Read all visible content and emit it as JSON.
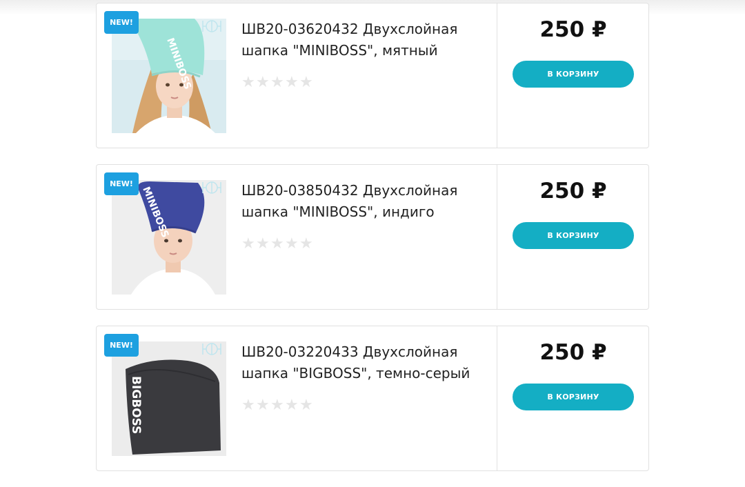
{
  "products": [
    {
      "badge": "NEW!",
      "title": "ШВ20-03620432 Двухслойная шапка \"MINIBOSS\", мятный",
      "price": "250 ₽",
      "rating_stars": 5,
      "rating_value": 0,
      "cart_label": "В КОРЗИНУ",
      "hat_print": "MINIBOSS",
      "hat_color": "#9ee3d8",
      "bg_color": "#d9ebf0"
    },
    {
      "badge": "NEW!",
      "title": "ШВ20-03850432 Двухслойная шапка \"MINIBOSS\", индиго",
      "price": "250 ₽",
      "rating_stars": 5,
      "rating_value": 0,
      "cart_label": "В КОРЗИНУ",
      "hat_print": "MINIBOSS",
      "hat_color": "#3f4aa0",
      "bg_color": "#eeeeee"
    },
    {
      "badge": "NEW!",
      "title": "ШВ20-03220433 Двухслойная шапка \"BIGBOSS\", темно-серый",
      "price": "250 ₽",
      "rating_stars": 5,
      "rating_value": 0,
      "cart_label": "В КОРЗИНУ",
      "hat_print": "BIGBOSS",
      "hat_color": "#3a3a3e",
      "bg_color": "#ececec"
    }
  ],
  "colors": {
    "badge": "#1da0e0",
    "cart_button": "#14aec4",
    "star_empty": "#e5e5e5",
    "border": "#e1e1e1"
  }
}
